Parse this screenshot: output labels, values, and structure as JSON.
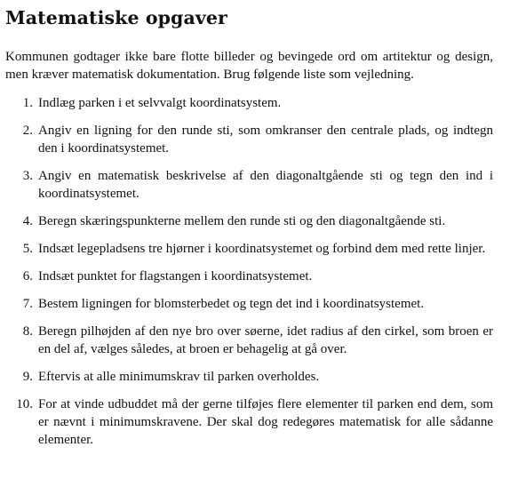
{
  "document": {
    "title": "Matematiske opgaver",
    "intro": "Kommunen godtager ikke bare flotte billeder og bevingede ord om artitektur og design, men kræver matematisk dokumentation. Brug følgende liste som vejledning.",
    "tasks": [
      {
        "number": "1.",
        "text": "Indlæg parken i et selvvalgt koordinatsystem."
      },
      {
        "number": "2.",
        "text": "Angiv en ligning for den runde sti, som omkranser den centrale plads, og indtegn den i koordinatsystemet."
      },
      {
        "number": "3.",
        "text": "Angiv en matematisk beskrivelse af den diagonaltgående sti og tegn den ind i koordinatsystemet."
      },
      {
        "number": "4.",
        "text": "Beregn skæringspunkterne mellem den runde sti og den diagonaltgående sti."
      },
      {
        "number": "5.",
        "text": "Indsæt legepladsens tre hjørner i koordinatsystemet og forbind dem med rette linjer."
      },
      {
        "number": "6.",
        "text": "Indsæt punktet for flagstangen i koordinatsystemet."
      },
      {
        "number": "7.",
        "text": "Bestem ligningen for blomsterbedet og tegn det ind i koordinatsystemet."
      },
      {
        "number": "8.",
        "text": "Beregn pilhøjden af den nye bro over søerne, idet radius af den cirkel, som broen er en del af, vælges således, at broen er behagelig at gå over."
      },
      {
        "number": "9.",
        "text": "Eftervis at alle minimumskrav til parken overholdes."
      },
      {
        "number": "10.",
        "text": "For at vinde udbuddet må der gerne tilføjes flere elementer til parken end dem, som er nævnt i minimumskravene. Der skal dog redegøres matematisk for alle sådanne elementer."
      }
    ]
  }
}
